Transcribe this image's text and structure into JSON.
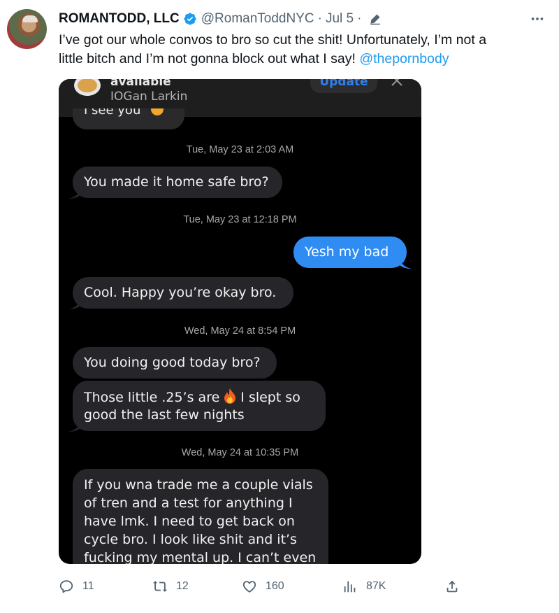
{
  "tweet": {
    "display_name": "ROMANTODD, LLC",
    "handle": "@RomanToddNYC",
    "separator": "·",
    "date": "Jul 5",
    "date_separator": "·",
    "text_line_1": "I’ve got our whole convos to bro so cut the shit! Unfortunately, I’m not a",
    "text_line_2": "little bitch and I’m not gonna block out what I say! ",
    "mention": "@thepornbody",
    "accent_color": "#1d9bf0"
  },
  "screenshot": {
    "top_bar": {
      "status": "available",
      "contact_name": "IOGan Larkin",
      "update_label": "Update"
    },
    "partial_text": "I see you",
    "messages": [
      {
        "type": "timestamp",
        "day": "Tue, May 23 at",
        "time": "2:03 AM"
      },
      {
        "type": "received",
        "text": "You made it home safe bro?"
      },
      {
        "type": "timestamp",
        "day": "Tue, May 23 at",
        "time": "12:18 PM"
      },
      {
        "type": "sent",
        "text": "Yesh my bad"
      },
      {
        "type": "received",
        "text": "Cool. Happy you’re okay bro."
      },
      {
        "type": "timestamp",
        "day": "Wed, May 24 at",
        "time": "8:54 PM"
      },
      {
        "type": "received",
        "text": "You doing good today bro?"
      },
      {
        "type": "received",
        "text_before_emoji": "Those little .25’s are",
        "emoji": "fire",
        "text_after_emoji": "I slept so",
        "text_line_2": "good the last few nights"
      },
      {
        "type": "timestamp",
        "day": "Wed, May 24 at",
        "time": "10:35 PM"
      },
      {
        "type": "received",
        "lines": [
          "If you wna trade me a couple vials",
          "of tren and a test for anything I",
          "have lmk. I need to get back on",
          "cycle bro. I look like shit and it’s",
          "fucking my mental up. I can’t even"
        ]
      }
    ],
    "colors": {
      "sent_bubble": "#2f8cf3",
      "received_bubble": "#26262a",
      "background": "#000000"
    }
  },
  "actions": {
    "replies": "11",
    "reposts": "12",
    "likes": "160",
    "views": "87K",
    "icons": [
      "reply-icon",
      "repost-icon",
      "like-icon",
      "views-icon",
      "share-icon"
    ]
  }
}
